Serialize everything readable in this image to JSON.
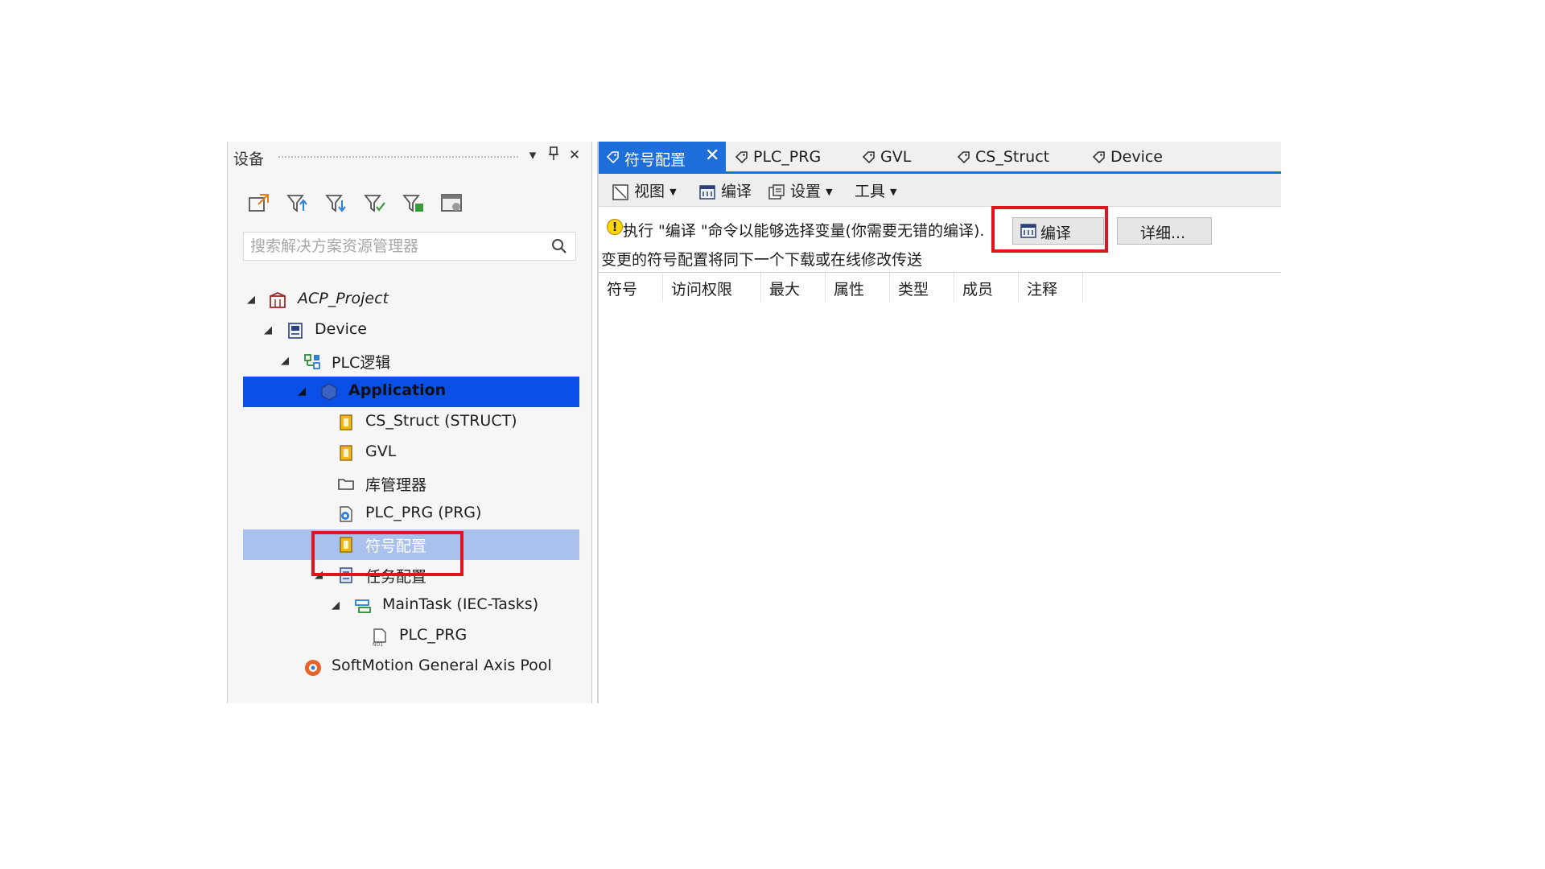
{
  "devices_pane": {
    "title": "设备",
    "search_placeholder": "搜索解决方案资源管理器",
    "toolbar_icons": [
      "new-object-icon",
      "filter-up-icon",
      "filter-down-icon",
      "filter-check-icon",
      "filter-add-icon",
      "settings-panel-icon"
    ],
    "tree": [
      {
        "label": "ACP_Project",
        "icon": "project-icon",
        "level": 0,
        "expanded": true
      },
      {
        "label": "Device",
        "icon": "device-icon",
        "level": 1,
        "expanded": true
      },
      {
        "label": "PLC逻辑",
        "icon": "plc-logic-icon",
        "level": 2,
        "expanded": true
      },
      {
        "label": "Application",
        "icon": "application-icon",
        "level": 3,
        "expanded": true,
        "selected": true
      },
      {
        "label": "CS_Struct (STRUCT)",
        "icon": "struct-icon",
        "level": 4
      },
      {
        "label": "GVL",
        "icon": "gvl-icon",
        "level": 4
      },
      {
        "label": "库管理器",
        "icon": "library-manager-icon",
        "level": 4
      },
      {
        "label": "PLC_PRG (PRG)",
        "icon": "program-icon",
        "level": 4
      },
      {
        "label": "符号配置",
        "icon": "symbol-config-icon",
        "level": 4,
        "highlighted": true
      },
      {
        "label": "任务配置",
        "icon": "task-config-icon",
        "level": 4,
        "expanded": true
      },
      {
        "label": "MainTask (IEC-Tasks)",
        "icon": "task-icon",
        "level": 5,
        "expanded": true
      },
      {
        "label": "PLC_PRG",
        "icon": "program-call-icon",
        "level": 6
      },
      {
        "label": "SoftMotion General Axis Pool",
        "icon": "axis-pool-icon",
        "level": 3
      }
    ]
  },
  "editor": {
    "tabs": [
      {
        "label": "符号配置",
        "active": true
      },
      {
        "label": "PLC_PRG"
      },
      {
        "label": "GVL"
      },
      {
        "label": "CS_Struct"
      },
      {
        "label": "Device"
      }
    ],
    "toolbar": {
      "view": "视图",
      "compile": "编译",
      "settings": "设置",
      "tools": "工具"
    },
    "info_message": "执行 \"编译 \"命令以能够选择变量(你需要无错的编译).",
    "compile_button": "编译",
    "detail_button": "详细...",
    "info_message2": "变更的符号配置将同下一个下载或在线修改传送",
    "columns": [
      "符号",
      "访问权限",
      "最大",
      "属性",
      "类型",
      "成员",
      "注释"
    ]
  },
  "colors": {
    "selection_blue": "#0a4fe6",
    "tab_active": "#1e6fd9",
    "highlight_red": "#e2131b"
  }
}
